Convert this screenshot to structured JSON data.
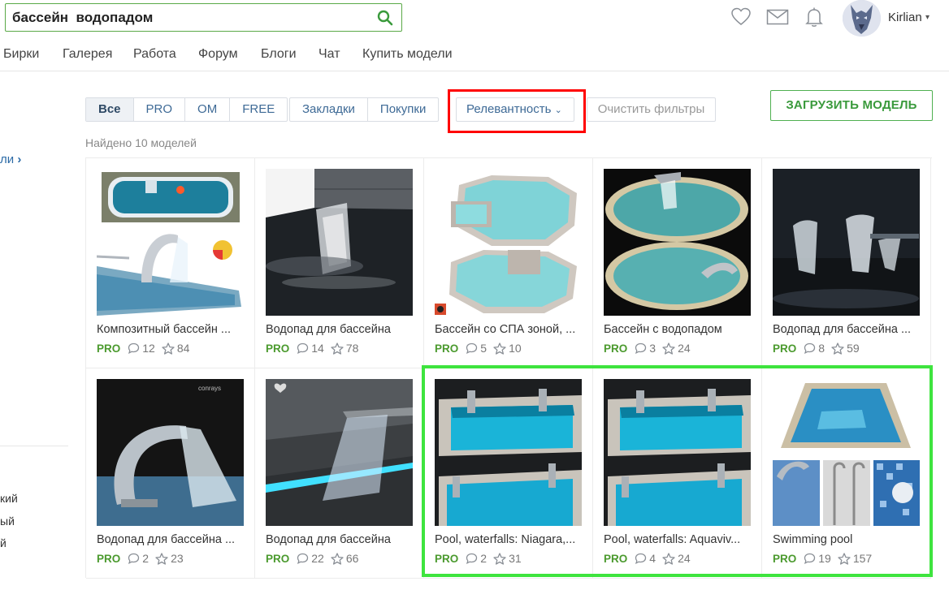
{
  "search": {
    "value": "бассейн  водопадом"
  },
  "user": {
    "name": "Kirlian"
  },
  "nav": [
    "Бирки",
    "Галерея",
    "Работа",
    "Форум",
    "Блоги",
    "Чат",
    "Купить модели"
  ],
  "sidebar": {
    "link_fragment": "ли",
    "items": [
      "кий",
      "ый",
      "й"
    ]
  },
  "filters": {
    "license": [
      "Все",
      "PRO",
      "OM",
      "FREE"
    ],
    "lists": [
      "Закладки",
      "Покупки"
    ],
    "sort_label": "Релевантность",
    "clear_label": "Очистить фильтры",
    "upload_label": "ЗАГРУЗИТЬ МОДЕЛЬ"
  },
  "found_text": "Найдено 10 моделей",
  "models": [
    {
      "title": "Композитный бассейн ...",
      "badge": "PRO",
      "comments": "12",
      "stars": "84",
      "thumb": "pool-rect"
    },
    {
      "title": "Водопад для бассейна",
      "badge": "PRO",
      "comments": "14",
      "stars": "78",
      "thumb": "wall-waterfall"
    },
    {
      "title": "Бассейн со СПА зоной, ...",
      "badge": "PRO",
      "comments": "5",
      "stars": "10",
      "thumb": "octagon-spa"
    },
    {
      "title": "Бассейн с водопадом",
      "badge": "PRO",
      "comments": "3",
      "stars": "24",
      "thumb": "round-pool"
    },
    {
      "title": "Водопад для бассейна ...",
      "badge": "PRO",
      "comments": "8",
      "stars": "59",
      "thumb": "dark-fountains"
    },
    {
      "title": "Водопад для бассейна ...",
      "badge": "PRO",
      "comments": "2",
      "stars": "23",
      "thumb": "arc-fountain",
      "brand": "conrays"
    },
    {
      "title": "Водопад для бассейна",
      "badge": "PRO",
      "comments": "22",
      "stars": "66",
      "thumb": "glow-waterfall"
    },
    {
      "title": "Pool, waterfalls: Niagara,...",
      "badge": "PRO",
      "comments": "2",
      "stars": "31",
      "thumb": "glass-pool"
    },
    {
      "title": "Pool, waterfalls: Aquaviv...",
      "badge": "PRO",
      "comments": "4",
      "stars": "24",
      "thumb": "glass-pool"
    },
    {
      "title": "Swimming pool",
      "badge": "PRO",
      "comments": "19",
      "stars": "157",
      "thumb": "swimming-pool-collage"
    }
  ],
  "colors": {
    "accent_green": "#4b9a2e",
    "link_blue": "#3e6a96",
    "highlight_red": "#ff0000",
    "highlight_green": "#3ee43e"
  }
}
